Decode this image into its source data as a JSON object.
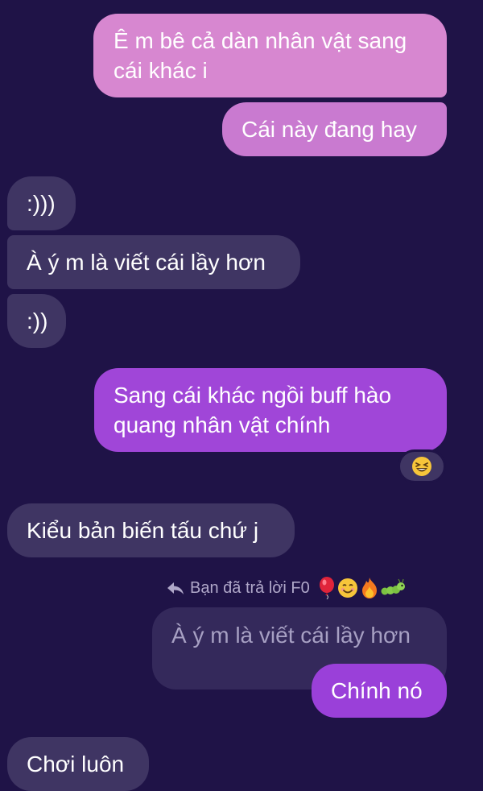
{
  "messages": {
    "m1": "Ê m bê cả dàn nhân vật sang cái khác i",
    "m2": "Cái này đang hay",
    "m3": ":)))",
    "m4": "À ý m là viết cái lầy hơn",
    "m5": ":))",
    "m6": "Sang cái khác ngồi buff hào quang nhân vật chính",
    "m7": "Kiểu bản biến tấu chứ j",
    "quoted": "À ý m là viết cái lầy hơn",
    "m8": "Chính nó",
    "m9": "Chơi luôn"
  },
  "reply_note": {
    "text": "Bạn đã trả lời F0",
    "icon": "reply-arrow-icon",
    "emojis": [
      "balloon-icon",
      "smiling-face-icon",
      "fire-icon",
      "caterpillar-icon"
    ]
  },
  "reaction": {
    "icon": "grinning-squinting-face-icon"
  },
  "colors": {
    "background": "#1f1347",
    "incoming_bubble": "#3f3563",
    "outgoing_pink": "#d787d0",
    "outgoing_purple": "#a046d8",
    "quoted_bubble": "#34295b"
  }
}
